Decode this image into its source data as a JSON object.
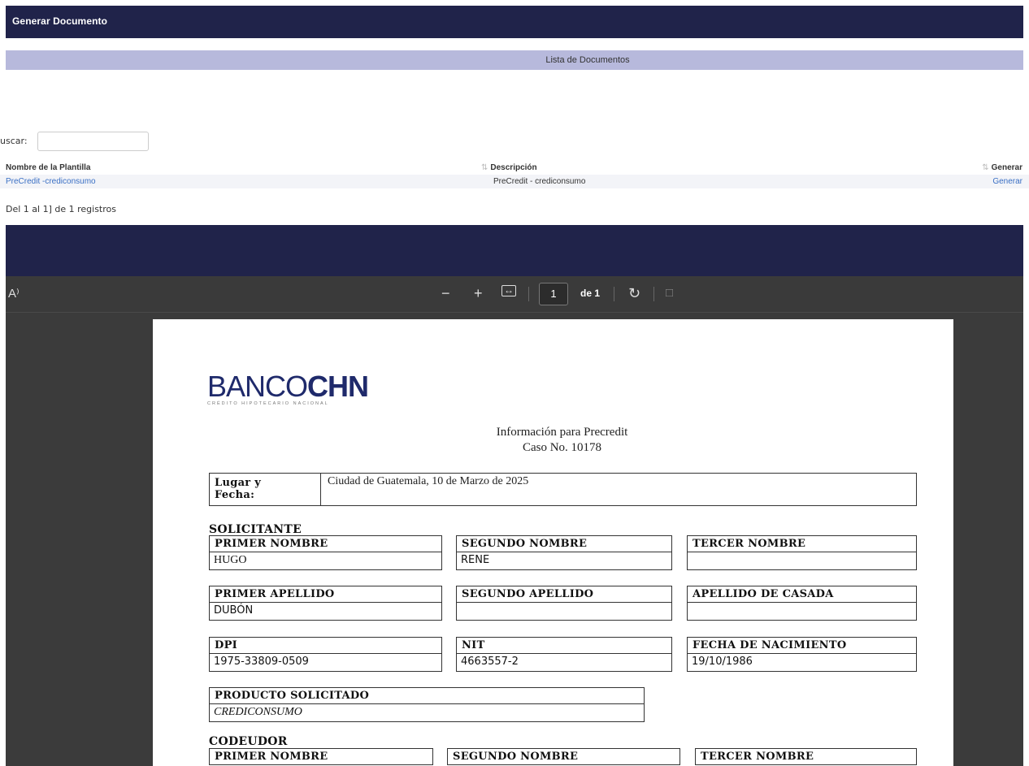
{
  "header": {
    "title": "Generar Documento"
  },
  "subheader": {
    "label": "Lista de Documentos"
  },
  "search": {
    "label": "uscar:",
    "value": ""
  },
  "table": {
    "columns": [
      "Nombre de la Plantilla",
      "Descripción",
      "Generar"
    ],
    "rows": [
      {
        "nombre": "PreCredit -crediconsumo",
        "descripcion": "PreCredit - crediconsumo",
        "accion": "Generar"
      }
    ],
    "info": "Del 1 al 1] de 1 registros"
  },
  "viewer": {
    "read_aloud": "A⁾",
    "zoom_out": "−",
    "zoom_in": "+",
    "fit": "↔",
    "page_current": "1",
    "page_total": "de 1",
    "rotate": "↻",
    "two_page": "□"
  },
  "document": {
    "logo": {
      "part1": "BANCO",
      "part2": "CHN",
      "tagline": "CRÉDITO HIPOTECARIO NACIONAL"
    },
    "title_line1": "Información para Precredit",
    "title_line2": "Caso No. 10178",
    "lugar_label_1": "Lugar y",
    "lugar_label_2": "Fecha:",
    "lugar_value": "Ciudad de Guatemala, 10 de Marzo de 2025",
    "solicitante_title": "SOLICITANTE",
    "solicitante": {
      "primer_nombre": {
        "label": "PRIMER NOMBRE",
        "value": "HUGO"
      },
      "segundo_nombre": {
        "label": "SEGUNDO NOMBRE",
        "value": "RENE"
      },
      "tercer_nombre": {
        "label": "TERCER NOMBRE",
        "value": ""
      },
      "primer_apellido": {
        "label": "PRIMER APELLIDO",
        "value": "DUBÓN"
      },
      "segundo_apellido": {
        "label": "SEGUNDO APELLIDO",
        "value": ""
      },
      "apellido_casada": {
        "label": "APELLIDO DE CASADA",
        "value": ""
      },
      "dpi": {
        "label": "DPI",
        "value": "1975-33809-0509"
      },
      "nit": {
        "label": "NIT",
        "value": "4663557-2"
      },
      "fecha_nacimiento": {
        "label": "FECHA DE NACIMIENTO",
        "value": "19/10/1986"
      }
    },
    "producto": {
      "label": "PRODUCTO SOLICITADO",
      "value": "CREDICONSUMO"
    },
    "codeudor_title": "CODEUDOR",
    "codeudor": {
      "primer_nombre": {
        "label": "PRIMER NOMBRE"
      },
      "segundo_nombre": {
        "label": "SEGUNDO NOMBRE"
      },
      "tercer_nombre": {
        "label": "TERCER NOMBRE"
      }
    }
  }
}
